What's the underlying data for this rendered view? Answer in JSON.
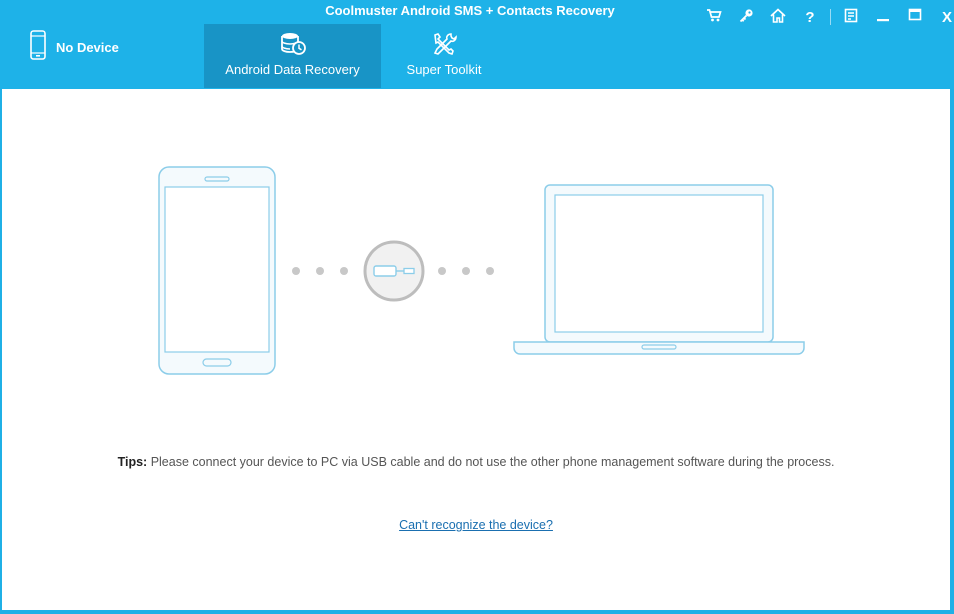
{
  "window": {
    "title": "Coolmuster Android SMS + Contacts Recovery"
  },
  "device": {
    "status": "No Device",
    "icon": "phone-icon"
  },
  "tabs": [
    {
      "label": "Android Data Recovery",
      "icon": "database-clock-icon",
      "active": true
    },
    {
      "label": "Super Toolkit",
      "icon": "tools-icon",
      "active": false
    }
  ],
  "window_controls": {
    "cart": "cart-icon",
    "key": "key-icon",
    "home": "home-icon",
    "help": "?",
    "feedback": "feedback-icon",
    "minimize": "minimize-icon",
    "maximize": "maximize-icon",
    "close": "X"
  },
  "tips": {
    "label": "Tips:",
    "text": "Please connect your device to PC via USB cable and do not use the other phone management software during the process."
  },
  "help_link": "Can't recognize the device?",
  "colors": {
    "header": "#1eb2e8",
    "active_tab": "#1894c6",
    "outline": "#8ccde9",
    "link": "#1a6fb0"
  }
}
